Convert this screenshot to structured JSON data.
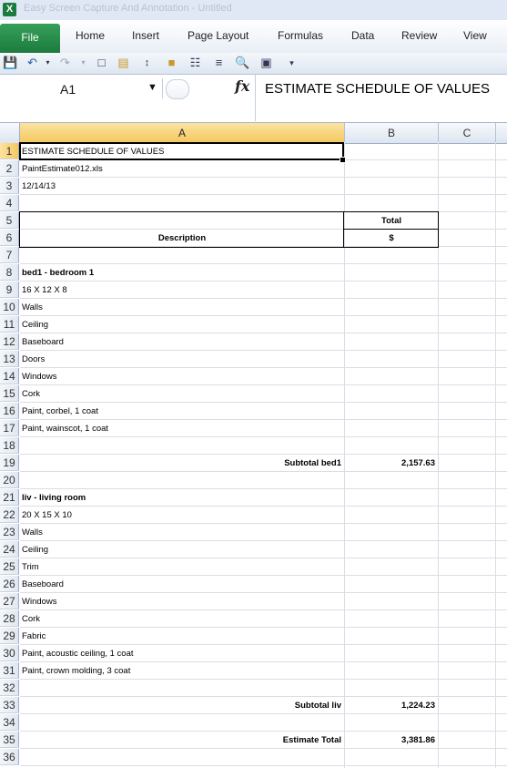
{
  "window": {
    "title": "Easy Screen Capture And Annotation - Untitled",
    "app_icon": "X"
  },
  "ribbon": {
    "file_label": "File",
    "tabs": [
      "Home",
      "Insert",
      "Page Layout",
      "Formulas",
      "Data",
      "Review",
      "View"
    ]
  },
  "quick_access": {
    "icons": [
      "save-icon",
      "undo-icon",
      "undo-dropdown-icon",
      "redo-icon",
      "redo-dropdown-icon",
      "new-icon",
      "open-icon",
      "sort-icon",
      "folder-icon",
      "find-icon",
      "outline-icon",
      "print-preview-icon",
      "options-icon",
      "customize-dropdown-icon"
    ]
  },
  "formula_bar": {
    "name_box": "A1",
    "fx_label": "fx",
    "value": "ESTIMATE SCHEDULE OF VALUES"
  },
  "columns": [
    "A",
    "B",
    "C"
  ],
  "selected": {
    "column": "A",
    "row": "1"
  },
  "rows": [
    {
      "n": "1",
      "a": "ESTIMATE SCHEDULE OF VALUES",
      "b": ""
    },
    {
      "n": "2",
      "a": "PaintEstimate012.xls",
      "b": ""
    },
    {
      "n": "3",
      "a": "12/14/13",
      "b": ""
    },
    {
      "n": "4",
      "a": "",
      "b": ""
    },
    {
      "n": "5",
      "a": "",
      "b": "Total"
    },
    {
      "n": "6",
      "a": "Description",
      "b": "$"
    },
    {
      "n": "7",
      "a": "",
      "b": ""
    },
    {
      "n": "8",
      "a": "bed1 - bedroom 1",
      "b": ""
    },
    {
      "n": "9",
      "a": "16 X 12 X 8",
      "b": ""
    },
    {
      "n": "10",
      "a": "Walls",
      "b": ""
    },
    {
      "n": "11",
      "a": "Ceiling",
      "b": ""
    },
    {
      "n": "12",
      "a": "Baseboard",
      "b": ""
    },
    {
      "n": "13",
      "a": "Doors",
      "b": ""
    },
    {
      "n": "14",
      "a": "Windows",
      "b": ""
    },
    {
      "n": "15",
      "a": "Cork",
      "b": ""
    },
    {
      "n": "16",
      "a": "Paint, corbel, 1 coat",
      "b": ""
    },
    {
      "n": "17",
      "a": "Paint, wainscot, 1 coat",
      "b": ""
    },
    {
      "n": "18",
      "a": "",
      "b": ""
    },
    {
      "n": "19",
      "a": "Subtotal bed1",
      "b": "2,157.63"
    },
    {
      "n": "20",
      "a": "",
      "b": ""
    },
    {
      "n": "21",
      "a": "liv - living room",
      "b": ""
    },
    {
      "n": "22",
      "a": "20 X 15 X 10",
      "b": ""
    },
    {
      "n": "23",
      "a": "Walls",
      "b": ""
    },
    {
      "n": "24",
      "a": "Ceiling",
      "b": ""
    },
    {
      "n": "25",
      "a": "Trim",
      "b": ""
    },
    {
      "n": "26",
      "a": "Baseboard",
      "b": ""
    },
    {
      "n": "27",
      "a": "Windows",
      "b": ""
    },
    {
      "n": "28",
      "a": "Cork",
      "b": ""
    },
    {
      "n": "29",
      "a": "Fabric",
      "b": ""
    },
    {
      "n": "30",
      "a": "Paint, acoustic ceiling, 1 coat",
      "b": ""
    },
    {
      "n": "31",
      "a": "Paint, crown molding, 3 coat",
      "b": ""
    },
    {
      "n": "32",
      "a": "",
      "b": ""
    },
    {
      "n": "33",
      "a": "Subtotal liv",
      "b": "1,224.23"
    },
    {
      "n": "34",
      "a": "",
      "b": ""
    },
    {
      "n": "35",
      "a": "Estimate Total",
      "b": "3,381.86"
    },
    {
      "n": "36",
      "a": "",
      "b": ""
    }
  ],
  "colors": {
    "file_tab": "#1d7b3e",
    "selection_header": "#f4c862",
    "header_bg": "#dde5ef",
    "gridline": "#d8dee6"
  }
}
